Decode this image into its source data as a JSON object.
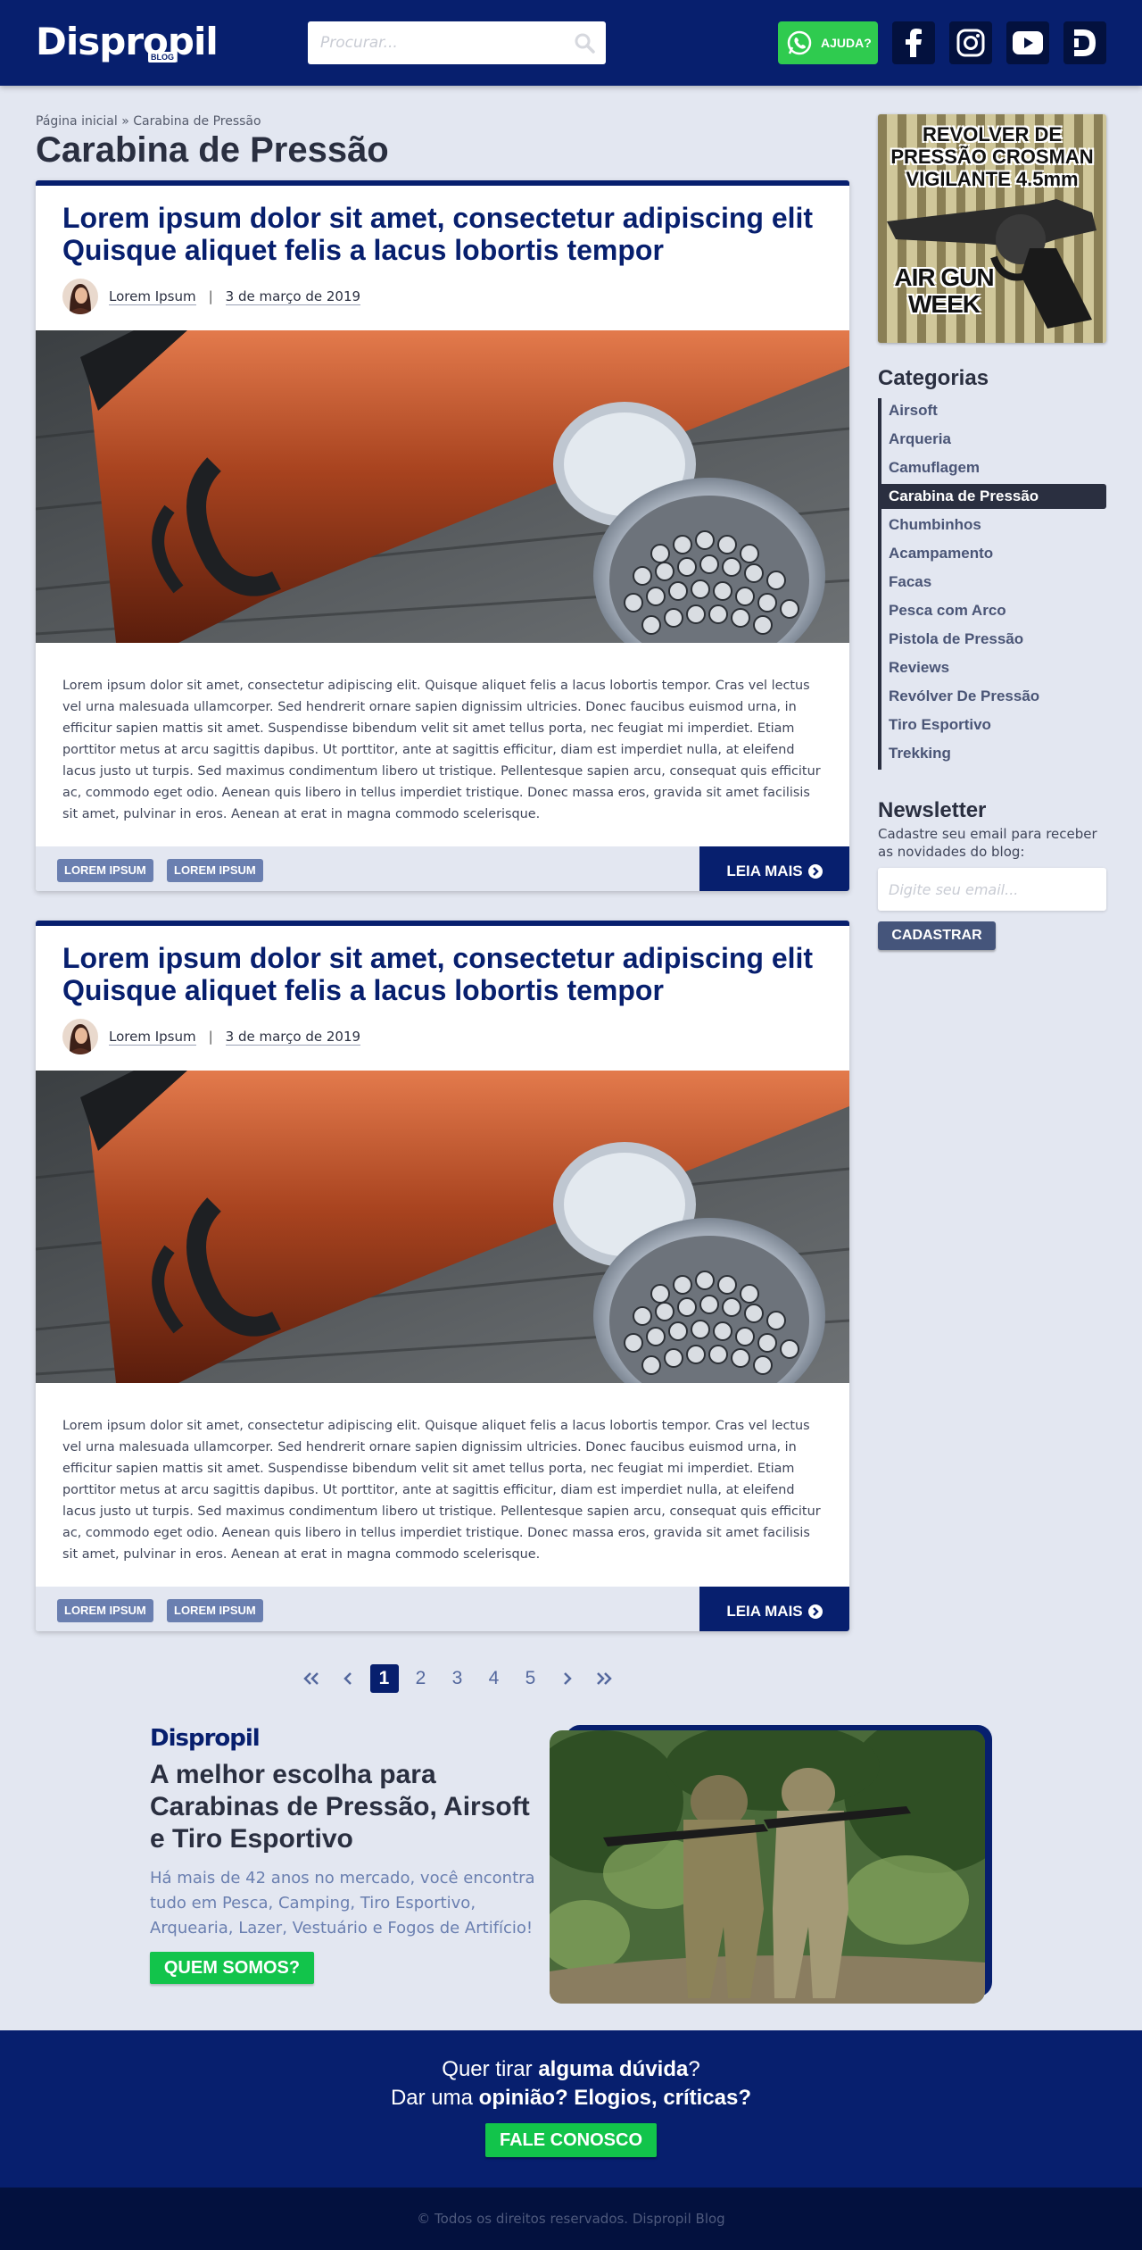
{
  "header": {
    "logo": "Dispropil",
    "logo_badge": "BLOG",
    "search_placeholder": "Procurar...",
    "help_label": "AJUDA?",
    "social_icons": [
      "facebook-icon",
      "instagram-icon",
      "youtube-icon",
      "dispropil-icon"
    ]
  },
  "breadcrumb": {
    "home": "Página inicial",
    "separator": "»",
    "current": "Carabina de Pressão"
  },
  "page_title": "Carabina de Pressão",
  "posts": [
    {
      "title": "Lorem ipsum dolor sit amet, consectetur adipiscing elit Quisque aliquet felis a lacus lobortis tempor",
      "author": "Lorem Ipsum",
      "date": "3 de março de 2019",
      "excerpt": "Lorem ipsum dolor sit amet, consectetur adipiscing elit. Quisque aliquet felis a lacus lobortis tempor. Cras vel lectus vel urna malesuada ullamcorper. Sed hendrerit ornare sapien dignissim ultricies. Donec faucibus euismod urna, in efficitur sapien mattis sit amet. Suspendisse bibendum velit sit amet tellus porta, nec feugiat mi imperdiet. Etiam porttitor metus at arcu sagittis dapibus. Ut porttitor, ante at sagittis efficitur, diam est imperdiet nulla, at eleifend lacus justo ut turpis. Sed maximus condimentum libero ut tristique. Pellentesque sapien arcu, consequat quis efficitur ac, commodo eget odio. Aenean quis libero in tellus imperdiet tristique. Donec massa eros, gravida sit amet facilisis sit amet, pulvinar in eros. Aenean at erat in magna commodo scelerisque.",
      "tags": [
        "LOREM IPSUM",
        "LOREM IPSUM"
      ],
      "read_more": "LEIA MAIS"
    },
    {
      "title": "Lorem ipsum dolor sit amet, consectetur adipiscing elit Quisque aliquet felis a lacus lobortis tempor",
      "author": "Lorem Ipsum",
      "date": "3 de março de 2019",
      "excerpt": "Lorem ipsum dolor sit amet, consectetur adipiscing elit. Quisque aliquet felis a lacus lobortis tempor. Cras vel lectus vel urna malesuada ullamcorper. Sed hendrerit ornare sapien dignissim ultricies. Donec faucibus euismod urna, in efficitur sapien mattis sit amet. Suspendisse bibendum velit sit amet tellus porta, nec feugiat mi imperdiet. Etiam porttitor metus at arcu sagittis dapibus. Ut porttitor, ante at sagittis efficitur, diam est imperdiet nulla, at eleifend lacus justo ut turpis. Sed maximus condimentum libero ut tristique. Pellentesque sapien arcu, consequat quis efficitur ac, commodo eget odio. Aenean quis libero in tellus imperdiet tristique. Donec massa eros, gravida sit amet facilisis sit amet, pulvinar in eros. Aenean at erat in magna commodo scelerisque.",
      "tags": [
        "LOREM IPSUM",
        "LOREM IPSUM"
      ],
      "read_more": "LEIA MAIS"
    }
  ],
  "pagination": {
    "pages": [
      "1",
      "2",
      "3",
      "4",
      "5"
    ],
    "current": "1"
  },
  "sidebar": {
    "ad": {
      "line1": "REVOLVER DE PRESSÃO CROSMAN VIGILANTE 4.5mm",
      "line2": "AIR GUN WEEK"
    },
    "categories_title": "Categorias",
    "categories": [
      "Airsoft",
      "Arqueria",
      "Camuflagem",
      "Carabina de Pressão",
      "Chumbinhos",
      "Acampamento",
      "Facas",
      "Pesca com Arco",
      "Pistola de Pressão",
      "Reviews",
      "Revólver De Pressão",
      "Tiro Esportivo",
      "Trekking"
    ],
    "active_category": "Carabina de Pressão",
    "newsletter_title": "Newsletter",
    "newsletter_text": "Cadastre seu email para receber as novidades do blog:",
    "newsletter_placeholder": "Digite seu email...",
    "newsletter_button": "CADASTRAR"
  },
  "promo": {
    "logo": "Dispropil",
    "title": "A melhor escolha para Carabinas de Pressão, Airsoft e Tiro Esportivo",
    "description": "Há mais de 42 anos no mercado, você encontra tudo em Pesca, Camping, Tiro Esportivo, Arquearia, Lazer, Vestuário e Fogos de Artifício!",
    "button": "QUEM SOMOS?"
  },
  "contact": {
    "line1_pre": "Quer tirar ",
    "line1_bold": "alguma dúvida",
    "line1_post": "?",
    "line2_pre": "Dar uma ",
    "line2_bold": "opinião? Elogios, críticas?",
    "button": "FALE CONOSCO"
  },
  "footer": "© Todos os direitos reservados. Dispropil Blog",
  "colors": {
    "primary": "#071f6e",
    "accent_green": "#12c44b",
    "background": "#e3e7f1",
    "tag": "#6a7fb0"
  }
}
